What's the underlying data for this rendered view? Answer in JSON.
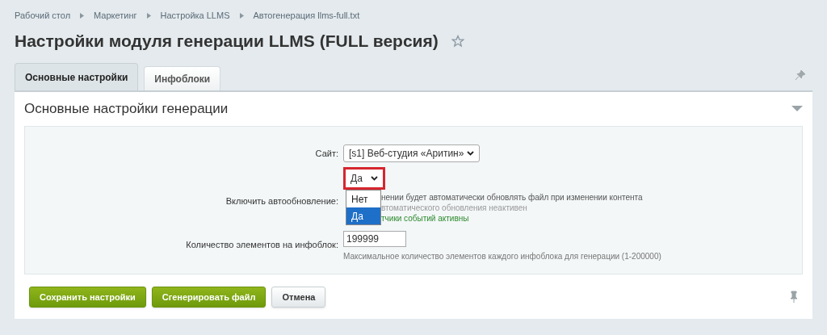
{
  "breadcrumbs": [
    "Рабочий стол",
    "Маркетинг",
    "Настройка LLMS",
    "Автогенерация llms-full.txt"
  ],
  "title": "Настройки модуля генерации LLMS (FULL версия)",
  "favorite": false,
  "tabs": [
    {
      "label": "Основные настройки",
      "selected": true
    },
    {
      "label": "Инфоблоки",
      "selected": false
    }
  ],
  "section": {
    "title": "Основные настройки генерации",
    "expanded": true
  },
  "site": {
    "label": "Сайт:",
    "value": "[s1] Веб-студия «Аритин»"
  },
  "autoupdate": {
    "label": "Включить автообновление:",
    "value": "Да",
    "highlighted": true,
    "options": [
      {
        "label": "Нет",
        "selected": false
      },
      {
        "label": "Да",
        "selected": true
      }
    ],
    "hints": [
      {
        "text": "нении будет автоматически обновлять файл при изменении контента",
        "kind": "info"
      },
      {
        "text": "втоматического обновления неактивен",
        "kind": "muted"
      },
      {
        "text": "тчики событий активны",
        "kind": "success"
      }
    ]
  },
  "count": {
    "label": "Количество элементов на инфоблок:",
    "value": "199999",
    "hint": "Максимальное количество элементов каждого инфоблока для генерации (1-200000)"
  },
  "buttons": [
    {
      "label": "Сохранить настройки",
      "kind": "primary"
    },
    {
      "label": "Сгенерировать файл",
      "kind": "primary"
    },
    {
      "label": "Отмена",
      "kind": "default"
    }
  ]
}
